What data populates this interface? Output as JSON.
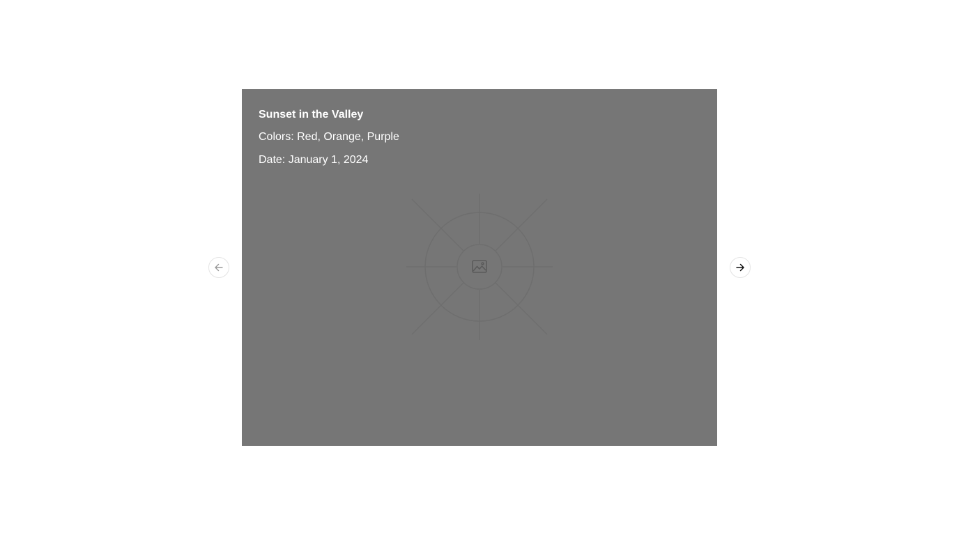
{
  "slide": {
    "title": "Sunset in the Valley",
    "colors": "Colors: Red, Orange, Purple",
    "date": "Date: January 1, 2024",
    "image_icon": "image-placeholder-icon"
  },
  "nav": {
    "prev_icon": "arrow-left-icon",
    "next_icon": "arrow-right-icon"
  },
  "colors": {
    "card_background": "#767676",
    "text": "#ffffff",
    "prev_arrow": "#9a9a9a",
    "next_arrow": "#111111"
  }
}
